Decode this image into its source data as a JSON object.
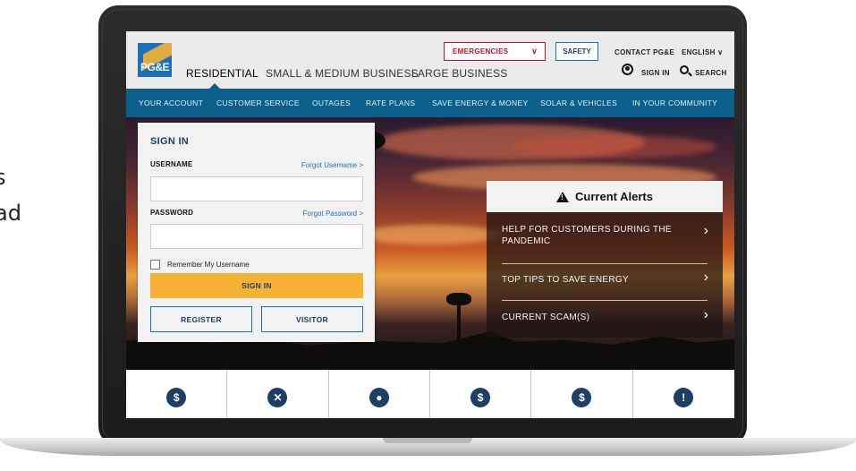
{
  "background_text": {
    "line1": "s",
    "line2": "ad"
  },
  "logo": {
    "text": "PG&E"
  },
  "header": {
    "nav": [
      {
        "label": "RESIDENTIAL",
        "active": true
      },
      {
        "label": "SMALL & MEDIUM BUSINESS",
        "active": false
      },
      {
        "label": "LARGE BUSINESS",
        "active": false
      }
    ],
    "emergencies_label": "EMERGENCIES",
    "safety_label": "SAFETY",
    "contact_label": "CONTACT PG&E",
    "language_label": "ENGLISH",
    "signin_label": "SIGN IN",
    "search_label": "SEARCH"
  },
  "subnav": [
    "YOUR ACCOUNT",
    "CUSTOMER SERVICE",
    "OUTAGES",
    "RATE PLANS",
    "SAVE ENERGY & MONEY",
    "SOLAR & VEHICLES",
    "IN YOUR COMMUNITY"
  ],
  "signin": {
    "title": "SIGN IN",
    "username_label": "USERNAME",
    "forgot_username": "Forgot Username >",
    "password_label": "PASSWORD",
    "forgot_password": "Forgot Password >",
    "username_value": "",
    "password_value": "",
    "remember_label": "Remember My Username",
    "remember_checked": false,
    "submit_label": "SIGN IN",
    "register_label": "REGISTER",
    "visitor_label": "VISITOR"
  },
  "alerts": {
    "title": "Current Alerts",
    "items": [
      "HELP FOR CUSTOMERS DURING THE PANDEMIC",
      "TOP TIPS TO SAVE ENERGY",
      "CURRENT SCAM(S)"
    ]
  },
  "quick_icons": [
    {
      "icon": "dollar-icon",
      "glyph": "$"
    },
    {
      "icon": "no-power-icon",
      "glyph": "✕"
    },
    {
      "icon": "lightbulb-icon",
      "glyph": "●"
    },
    {
      "icon": "hand-money-icon",
      "glyph": "$"
    },
    {
      "icon": "bill-icon",
      "glyph": "$"
    },
    {
      "icon": "warning-icon",
      "glyph": "!"
    }
  ],
  "colors": {
    "brand_blue": "#1d6fb8",
    "nav_blue": "#0b5f8a",
    "brand_yellow": "#f6b234",
    "emergency_red": "#c8102e"
  }
}
